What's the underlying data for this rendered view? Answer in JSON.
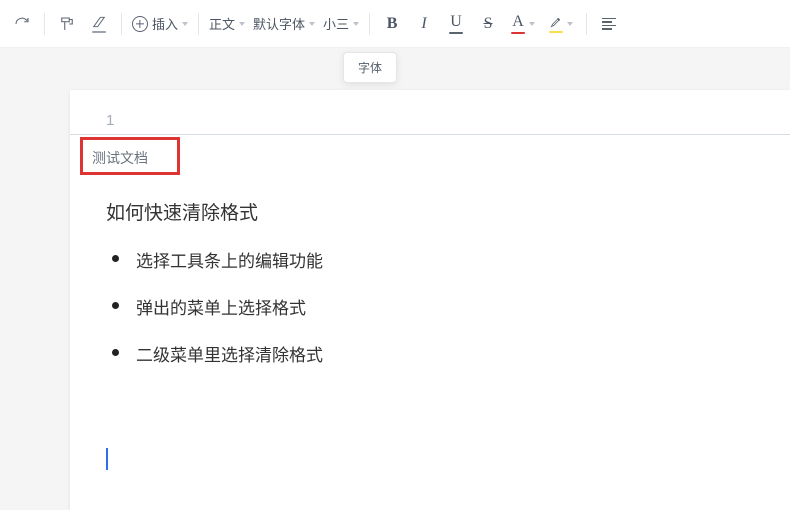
{
  "toolbar": {
    "insert_label": "插入",
    "style_label": "正文",
    "font_label": "默认字体",
    "size_label": "小三",
    "bold": "B",
    "italic": "I",
    "underline": "U",
    "strike": "S",
    "textcolor": "A",
    "highlight_glyph": "✎"
  },
  "tooltip": {
    "font": "字体"
  },
  "page": {
    "number": "1",
    "title_tab": "测试文档",
    "heading": "如何快速清除格式",
    "bullets": [
      "选择工具条上的编辑功能",
      "弹出的菜单上选择格式",
      "二级菜单里选择清除格式"
    ]
  }
}
